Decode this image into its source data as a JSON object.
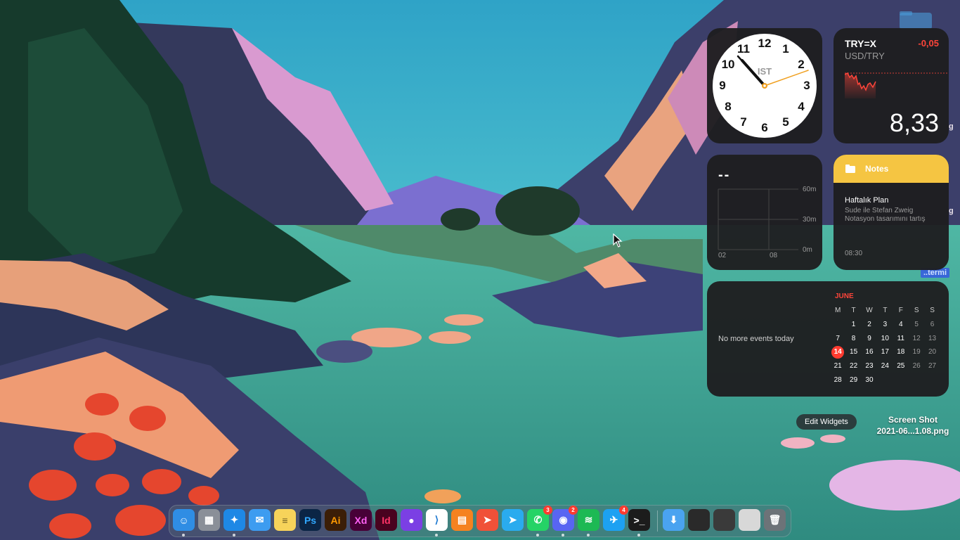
{
  "clock": {
    "city": "IST",
    "numbers": [
      "12",
      "1",
      "2",
      "3",
      "4",
      "5",
      "6",
      "7",
      "8",
      "9",
      "10",
      "11"
    ]
  },
  "stock": {
    "symbol": "TRY=X",
    "name": "USD/TRY",
    "change": "-0,05",
    "price": "8,33",
    "change_color": "#ff453a"
  },
  "screen_time": {
    "value": "--",
    "y_labels": [
      "60m",
      "30m",
      "0m"
    ],
    "x_labels": [
      "02",
      "08"
    ]
  },
  "notes": {
    "header": "Notes",
    "note_title": "Haftalık Plan",
    "note_body": "Sude ile Stefan Zweig Notasyon tasarımını tartış",
    "time": "08:30",
    "accent": "#f5c542"
  },
  "calendar": {
    "empty_text": "No more events today",
    "month": "JUNE",
    "weekdays": [
      "M",
      "T",
      "W",
      "T",
      "F",
      "S",
      "S"
    ],
    "weeks": [
      [
        "",
        "1",
        "2",
        "3",
        "4",
        "5",
        "6"
      ],
      [
        "7",
        "8",
        "9",
        "10",
        "11",
        "12",
        "13"
      ],
      [
        "14",
        "15",
        "16",
        "17",
        "18",
        "19",
        "20"
      ],
      [
        "21",
        "22",
        "23",
        "24",
        "25",
        "26",
        "27"
      ],
      [
        "28",
        "29",
        "30",
        "",
        "",
        "",
        ""
      ]
    ],
    "today": "14",
    "accent": "#ff3b30"
  },
  "desktop": {
    "edit_widgets": "Edit Widgets",
    "file_name_line1": "Screen Shot",
    "file_name_line2": "2021-06...1.08.png",
    "termi_label": "..termi"
  },
  "dock": {
    "apps": [
      {
        "name": "Finder",
        "glyph": "☺",
        "color": "#2f8de4",
        "running": true
      },
      {
        "name": "Launchpad",
        "glyph": "▦",
        "color": "#8a8f98",
        "running": false
      },
      {
        "name": "Safari",
        "glyph": "✦",
        "color": "#1e88e5",
        "running": true
      },
      {
        "name": "Mail",
        "glyph": "✉",
        "color": "#3d9cf0",
        "running": false
      },
      {
        "name": "Notes",
        "glyph": "≡",
        "color": "#f7d35a",
        "running": false
      },
      {
        "name": "Photoshop",
        "glyph": "Ps",
        "color": "#0b2545",
        "running": false
      },
      {
        "name": "Illustrator",
        "glyph": "Ai",
        "color": "#3b1e07",
        "running": false
      },
      {
        "name": "Adobe XD",
        "glyph": "Xd",
        "color": "#470137",
        "running": false
      },
      {
        "name": "InDesign",
        "glyph": "Id",
        "color": "#49021f",
        "running": false
      },
      {
        "name": "Firefox",
        "glyph": "●",
        "color": "#7b3fe4",
        "running": false
      },
      {
        "name": "Visual Studio Code",
        "glyph": "⟩",
        "color": "#ffffff",
        "running": true
      },
      {
        "name": "Books",
        "glyph": "▤",
        "color": "#f58220",
        "running": false
      },
      {
        "name": "Swift Playgrounds",
        "glyph": "➤",
        "color": "#f05138",
        "running": false
      },
      {
        "name": "Telegram",
        "glyph": "➤",
        "color": "#2aabee",
        "running": false
      },
      {
        "name": "WhatsApp",
        "glyph": "✆",
        "color": "#25d366",
        "running": true,
        "badge": "3"
      },
      {
        "name": "Discord",
        "glyph": "◉",
        "color": "#5865f2",
        "running": true,
        "badge": "2"
      },
      {
        "name": "Spotify",
        "glyph": "≋",
        "color": "#1db954",
        "running": true
      },
      {
        "name": "Twitter",
        "glyph": "✈",
        "color": "#1da1f2",
        "running": false,
        "badge": "4"
      },
      {
        "name": "Terminal",
        "glyph": ">_",
        "color": "#1c1c1c",
        "running": true
      }
    ],
    "others": [
      {
        "name": "Downloads",
        "glyph": "⬇",
        "color": "#4aa3f0"
      },
      {
        "name": "Window 1",
        "glyph": "",
        "color": "#2a2a2a"
      },
      {
        "name": "Window 2",
        "glyph": "",
        "color": "#3a3a3a"
      },
      {
        "name": "Window 3",
        "glyph": "",
        "color": "#d8d8d8"
      },
      {
        "name": "Trash",
        "glyph": "🗑",
        "color": "#6d7378"
      }
    ]
  }
}
